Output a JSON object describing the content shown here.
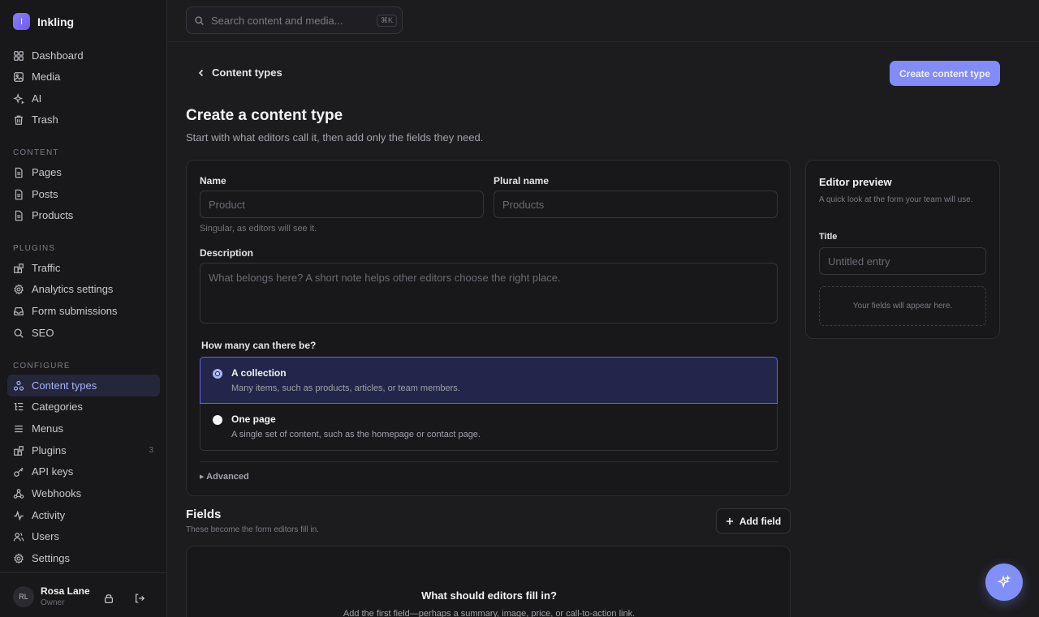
{
  "brand": {
    "logo_letter": "I",
    "name": "Inkling"
  },
  "search": {
    "placeholder": "Search content and media...",
    "shortcut": "⌘K"
  },
  "sidebar": {
    "top_items": [
      {
        "label": "Dashboard",
        "icon": "grid-icon"
      },
      {
        "label": "Media",
        "icon": "image-icon"
      },
      {
        "label": "AI",
        "icon": "sparkle-icon"
      },
      {
        "label": "Trash",
        "icon": "trash-icon"
      }
    ],
    "sections": {
      "content": "CONTENT",
      "plugins": "PLUGINS",
      "configure": "CONFIGURE"
    },
    "content_items": [
      {
        "label": "Pages",
        "icon": "document-icon"
      },
      {
        "label": "Posts",
        "icon": "document-icon"
      },
      {
        "label": "Products",
        "icon": "document-icon"
      }
    ],
    "plugin_items": [
      {
        "label": "Traffic",
        "icon": "blocks-icon"
      },
      {
        "label": "Analytics settings",
        "icon": "gear-icon"
      },
      {
        "label": "Form submissions",
        "icon": "inbox-icon"
      },
      {
        "label": "SEO",
        "icon": "search-icon"
      }
    ],
    "configure_items": [
      {
        "label": "Content types",
        "icon": "shapes-icon",
        "active": true
      },
      {
        "label": "Categories",
        "icon": "list-tree-icon"
      },
      {
        "label": "Menus",
        "icon": "menu-icon"
      },
      {
        "label": "Plugins",
        "icon": "blocks-icon",
        "badge": "3"
      },
      {
        "label": "API keys",
        "icon": "key-icon"
      },
      {
        "label": "Webhooks",
        "icon": "webhook-icon"
      },
      {
        "label": "Activity",
        "icon": "activity-icon"
      },
      {
        "label": "Users",
        "icon": "users-icon"
      },
      {
        "label": "Settings",
        "icon": "gear-icon"
      }
    ],
    "user": {
      "initials": "RL",
      "name": "Rosa Lane",
      "role": "Owner"
    }
  },
  "header": {
    "back_label": "Content types",
    "create_button": "Create content type",
    "title": "Create a content type",
    "subtitle": "Start with what editors call it, then add only the fields they need."
  },
  "form": {
    "name_label": "Name",
    "name_placeholder": "Product",
    "name_hint": "Singular, as editors will see it.",
    "plural_label": "Plural name",
    "plural_placeholder": "Products",
    "description_label": "Description",
    "description_placeholder": "What belongs here? A short note helps other editors choose the right place.",
    "count_label": "How many can there be?",
    "options": [
      {
        "title": "A collection",
        "desc": "Many items, such as products, articles, or team members.",
        "selected": true
      },
      {
        "title": "One page",
        "desc": "A single set of content, such as the homepage or contact page.",
        "selected": false
      }
    ],
    "advanced_label": "▸ Advanced"
  },
  "preview": {
    "title": "Editor preview",
    "subtitle": "A quick look at the form your team will use.",
    "field_label": "Title",
    "field_placeholder": "Untitled entry",
    "empty_text": "Your fields will appear here."
  },
  "fields": {
    "title": "Fields",
    "subtitle": "These become the form editors fill in.",
    "add_button": "Add field",
    "empty_title": "What should editors fill in?",
    "empty_subtitle": "Add the first field—perhaps a summary, image, price, or call-to-action link."
  },
  "colors": {
    "accent": "#818cf8",
    "active_bg": "#25263a",
    "selected_option_bg": "#23254a",
    "background": "#1c1c1f",
    "surface": "#18181b"
  }
}
